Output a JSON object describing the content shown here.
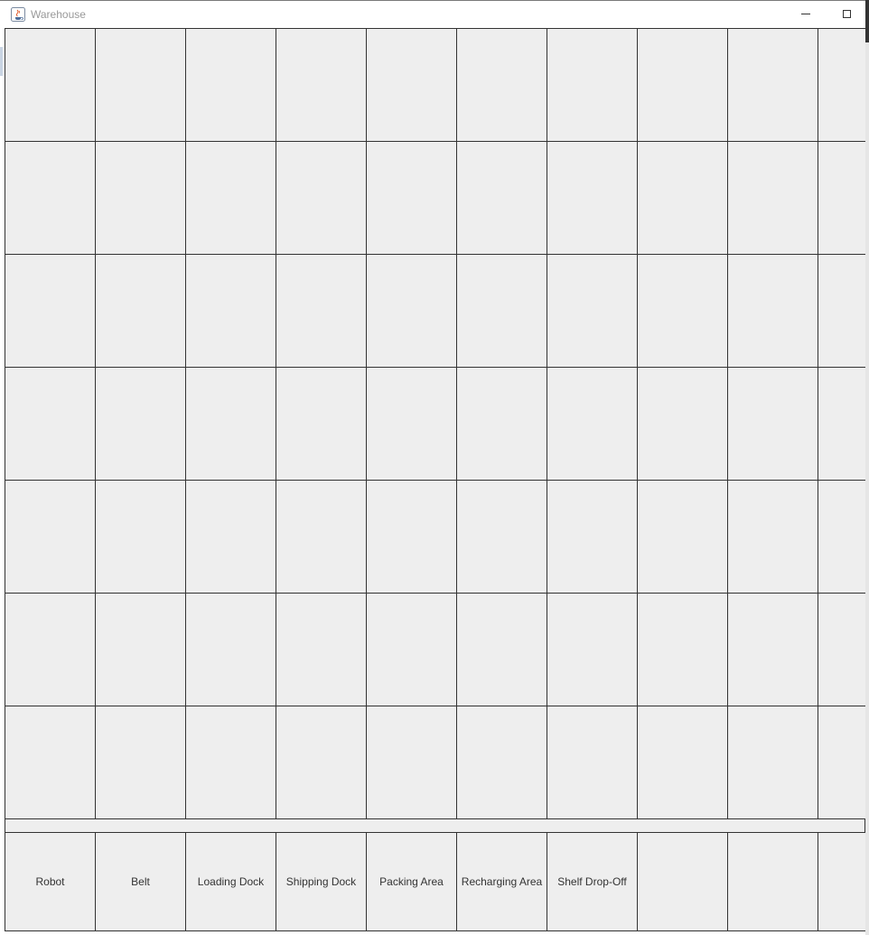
{
  "window": {
    "title": "Warehouse",
    "icon": "java-cup-icon"
  },
  "grid": {
    "rows": 7,
    "columns": 10
  },
  "legend": {
    "items": [
      "Robot",
      "Belt",
      "Loading Dock",
      "Shipping Dock",
      "Packing Area",
      "Recharging Area",
      "Shelf Drop-Off",
      "",
      "",
      ""
    ]
  },
  "colors": {
    "cell_background": "#eeeeee",
    "grid_lines": "#333333"
  }
}
